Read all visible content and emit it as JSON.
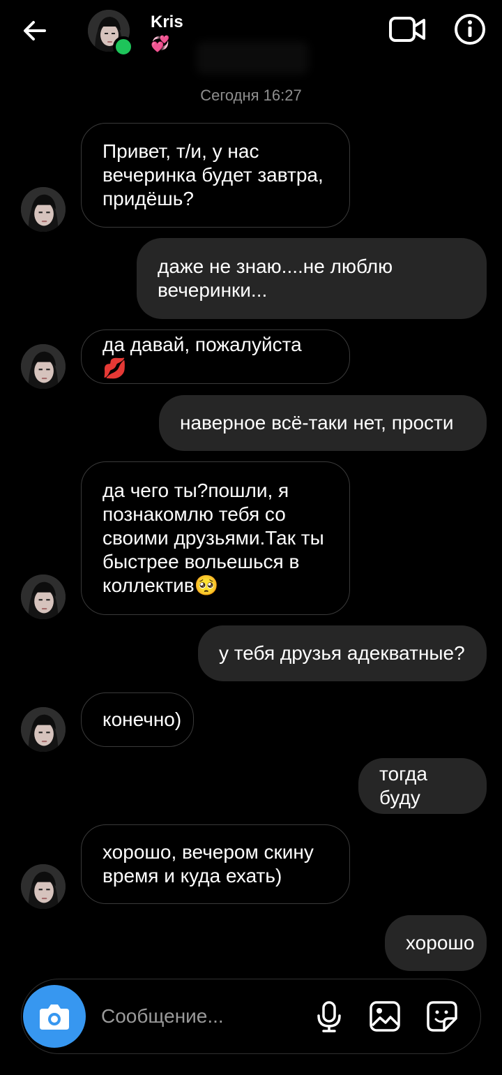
{
  "header": {
    "contact_name": "Kris",
    "status_emoji": "💞",
    "back_icon": "arrow-left-icon",
    "video_icon": "video-camera-icon",
    "info_icon": "info-icon"
  },
  "timestamp": "Сегодня 16:27",
  "messages": [
    {
      "from": "them",
      "lines": [
        "Привет, т/и, у нас",
        "вечеринка будет завтра,",
        "придёшь?"
      ]
    },
    {
      "from": "me",
      "lines": [
        "даже не знаю....не люблю",
        "вечеринки..."
      ]
    },
    {
      "from": "them",
      "lines": [
        "да давай, пожалуйста 💋"
      ]
    },
    {
      "from": "me",
      "lines": [
        "наверное всё-таки нет, прости"
      ]
    },
    {
      "from": "them",
      "lines": [
        "да чего ты?пошли, я",
        "познакомлю тебя со",
        "своими друзьями.Так ты",
        "быстрее вольешься в",
        "коллектив🥺"
      ]
    },
    {
      "from": "me",
      "lines": [
        "у тебя друзья адекватные?"
      ]
    },
    {
      "from": "them",
      "lines": [
        "конечно)"
      ]
    },
    {
      "from": "me",
      "lines": [
        "тогда буду"
      ]
    },
    {
      "from": "them",
      "lines": [
        "хорошо, вечером скину",
        "время и куда ехать)"
      ]
    },
    {
      "from": "me",
      "lines": [
        "хорошо"
      ]
    }
  ],
  "composer": {
    "placeholder": "Сообщение...",
    "icons": [
      "camera-icon",
      "microphone-icon",
      "gallery-icon",
      "sticker-icon"
    ]
  },
  "colors": {
    "background": "#000000",
    "outgoing_bubble": "#262626",
    "incoming_border": "#3a3a3a",
    "online": "#1ec45a",
    "camera_button": "#3797f0"
  }
}
